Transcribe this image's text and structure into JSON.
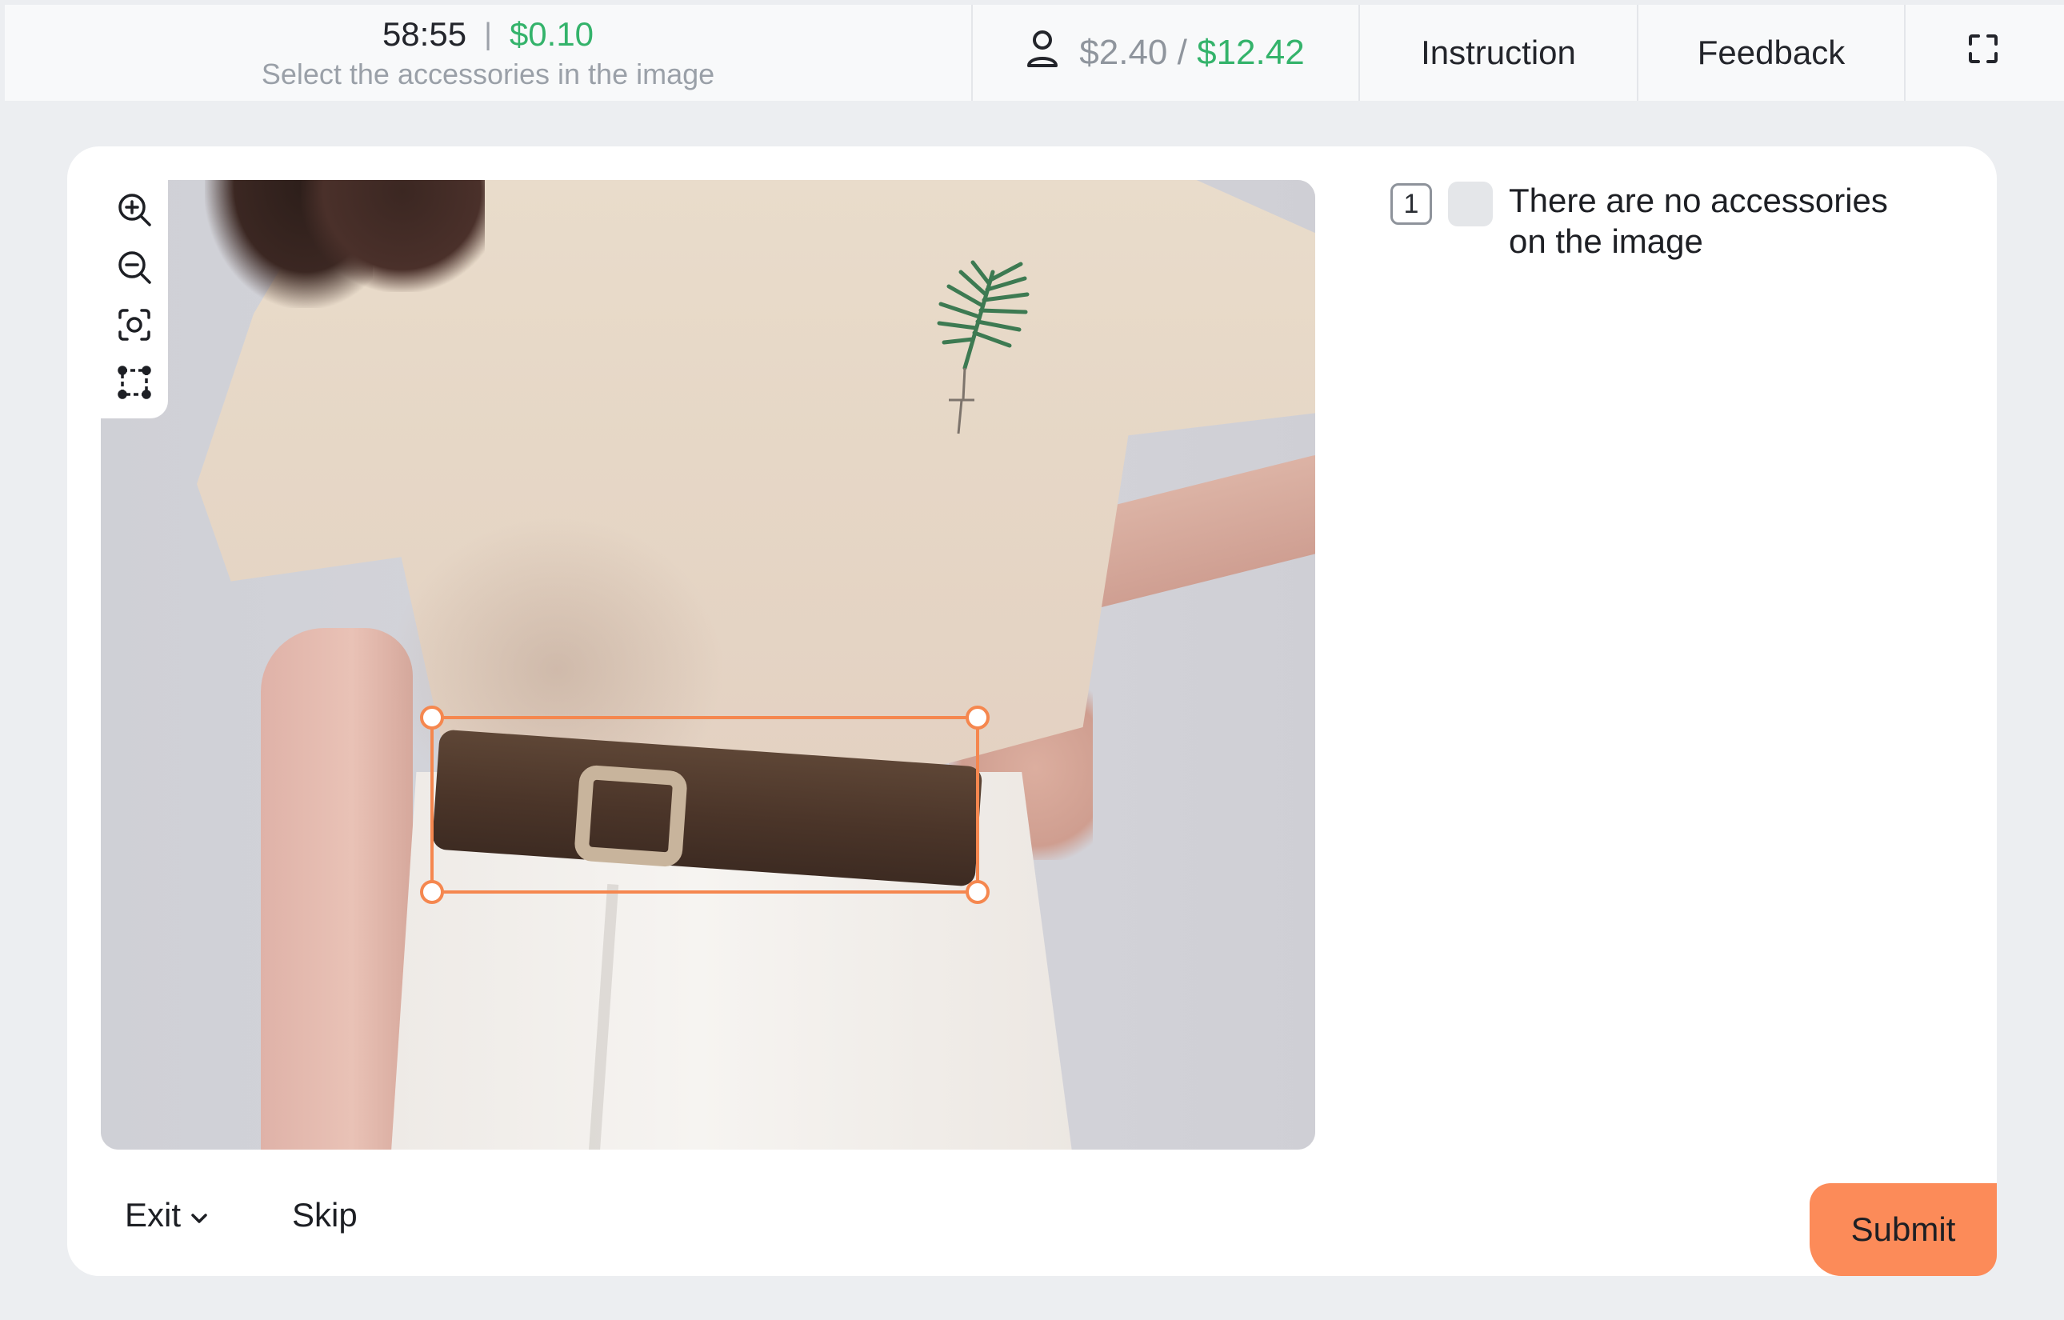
{
  "header": {
    "timer": "58:55",
    "separator": "|",
    "task_price": "$0.10",
    "task_instruction": "Select the accessories in the image",
    "earned_spent": "$2.40",
    "earned_separator": "/",
    "earned_total": "$12.42",
    "instruction_label": "Instruction",
    "feedback_label": "Feedback",
    "icons": {
      "user": "user-icon",
      "fullscreen": "fullscreen-icon"
    }
  },
  "tools": [
    {
      "name": "zoom-in-icon"
    },
    {
      "name": "zoom-out-icon"
    },
    {
      "name": "fit-view-icon"
    },
    {
      "name": "bounding-box-tool-icon"
    }
  ],
  "labels": [
    {
      "hotkey": "1",
      "text": "There are no accessories on the image"
    }
  ],
  "footer": {
    "exit_label": "Exit",
    "skip_label": "Skip",
    "submit_label": "Submit"
  },
  "colors": {
    "accent": "#f5874f",
    "submit_bg": "#fc8b59",
    "money_green": "#34b36b"
  }
}
